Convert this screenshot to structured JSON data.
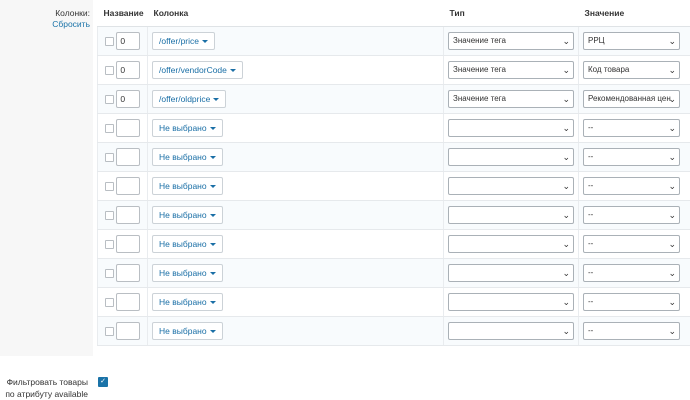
{
  "left": {
    "columns_label": "Колонки:",
    "reset_link": "Сбросить"
  },
  "headers": {
    "name": "Название",
    "column": "Колонка",
    "type": "Тип",
    "value": "Значение"
  },
  "rows": [
    {
      "name": "0",
      "column": "/offer/price",
      "type": "Значение тега",
      "value": "РРЦ"
    },
    {
      "name": "0",
      "column": "/offer/vendorCode",
      "type": "Значение тега",
      "value": "Код товара"
    },
    {
      "name": "0",
      "column": "/offer/oldprice",
      "type": "Значение тега",
      "value": "Рекомендованная цен"
    },
    {
      "name": "",
      "column": "Не выбрано",
      "type": "",
      "value": "--"
    },
    {
      "name": "",
      "column": "Не выбрано",
      "type": "",
      "value": "--"
    },
    {
      "name": "",
      "column": "Не выбрано",
      "type": "",
      "value": "--"
    },
    {
      "name": "",
      "column": "Не выбрано",
      "type": "",
      "value": "--"
    },
    {
      "name": "",
      "column": "Не выбрано",
      "type": "",
      "value": "--"
    },
    {
      "name": "",
      "column": "Не выбрано",
      "type": "",
      "value": "--"
    },
    {
      "name": "",
      "column": "Не выбрано",
      "type": "",
      "value": "--"
    },
    {
      "name": "",
      "column": "Не выбрано",
      "type": "",
      "value": "--"
    }
  ],
  "filter": {
    "label": "Фильтровать товары по атрибуту available",
    "checked": true
  },
  "icons": {
    "dropdown": "caret-down-icon",
    "select": "chevron-down-icon",
    "check": "checkmark-icon"
  },
  "colors": {
    "link": "#1a73a8",
    "row_alt": "#f8fbfd",
    "panel": "#f7f7f7"
  }
}
